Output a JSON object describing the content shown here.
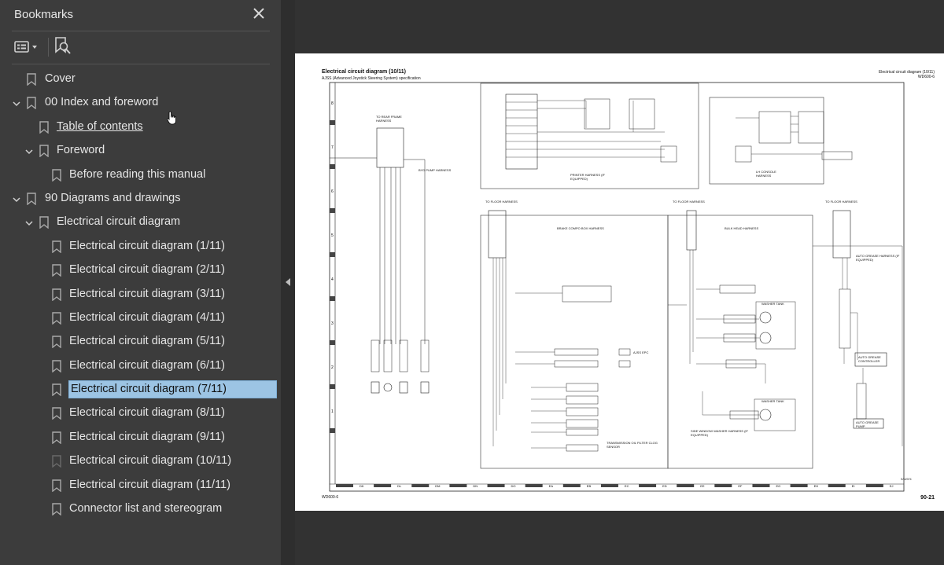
{
  "sidebar": {
    "title": "Bookmarks",
    "close_icon": "close-icon",
    "toolbar": {
      "options_icon": "bookmark-options-icon",
      "find_icon": "find-bookmark-icon"
    },
    "items": [
      {
        "label": "Cover",
        "level": 0,
        "expanded": null,
        "selected": false,
        "underline": false
      },
      {
        "label": "00 Index and foreword",
        "level": 0,
        "expanded": true,
        "selected": false,
        "underline": false
      },
      {
        "label": "Table of contents",
        "level": 1,
        "expanded": null,
        "selected": false,
        "underline": true
      },
      {
        "label": "Foreword",
        "level": 1,
        "expanded": true,
        "selected": false,
        "underline": false
      },
      {
        "label": "Before reading this manual",
        "level": 2,
        "expanded": null,
        "selected": false,
        "underline": false
      },
      {
        "label": "90 Diagrams and drawings",
        "level": 0,
        "expanded": true,
        "selected": false,
        "underline": false
      },
      {
        "label": "Electrical circuit diagram",
        "level": 1,
        "expanded": true,
        "selected": false,
        "underline": false
      },
      {
        "label": "Electrical circuit diagram (1/11)",
        "level": 2,
        "expanded": null,
        "selected": false,
        "underline": false
      },
      {
        "label": "Electrical circuit diagram (2/11)",
        "level": 2,
        "expanded": null,
        "selected": false,
        "underline": false
      },
      {
        "label": "Electrical circuit diagram (3/11)",
        "level": 2,
        "expanded": null,
        "selected": false,
        "underline": false
      },
      {
        "label": "Electrical circuit diagram (4/11)",
        "level": 2,
        "expanded": null,
        "selected": false,
        "underline": false
      },
      {
        "label": "Electrical circuit diagram (5/11)",
        "level": 2,
        "expanded": null,
        "selected": false,
        "underline": false
      },
      {
        "label": "Electrical circuit diagram (6/11)",
        "level": 2,
        "expanded": null,
        "selected": false,
        "underline": false
      },
      {
        "label": "Electrical circuit diagram (7/11)",
        "level": 2,
        "expanded": null,
        "selected": true,
        "underline": false
      },
      {
        "label": "Electrical circuit diagram (8/11)",
        "level": 2,
        "expanded": null,
        "selected": false,
        "underline": false
      },
      {
        "label": "Electrical circuit diagram (9/11)",
        "level": 2,
        "expanded": null,
        "selected": false,
        "underline": false
      },
      {
        "label": "Electrical circuit diagram (10/11)",
        "level": 2,
        "expanded": null,
        "selected": false,
        "underline": false
      },
      {
        "label": "Electrical circuit diagram (11/11)",
        "level": 2,
        "expanded": null,
        "selected": false,
        "underline": false
      },
      {
        "label": "Connector list and stereogram",
        "level": 2,
        "expanded": null,
        "selected": false,
        "underline": false
      }
    ]
  },
  "page": {
    "title": "Electrical circuit diagram (10/11)",
    "subtitle": "AJSS (Advanced Joystick Steering System) specification",
    "header_right_1": "Electrical circuit diagram (10/11)",
    "header_right_2": "WD600-6",
    "footer_left": "WD600-6",
    "footer_right": "90-21",
    "labels": {
      "to_rear_frame": "TO REAR FRAME HARNESS",
      "byd_pump": "BYD PUMP HARNESS",
      "printer_harness": "PRINTER HARNESS (IF EQUIPPED)",
      "to_floor_1": "TO FLOOR HARNESS",
      "to_floor_2": "TO FLOOR HARNESS",
      "to_floor_3": "TO FLOOR HARNESS",
      "brake_box": "BRAKE COMPO BOX HARNESS",
      "bulk_head": "BULK HEAD HARNESS",
      "auto_grease_harness": "AUTO GREASE HARNESS (IF EQUIPPED)",
      "lh_console": "LH CONSOLE HARNESS",
      "washer_tank_1": "WASHER TANK",
      "washer_tank_2": "WASHER TANK",
      "ajss_epc": "AJSS EPC",
      "side_window": "SIDE WINDOW WASHER HARNESS (IF EQUIPPED)",
      "auto_grease_ctrl": "AUTO GREASE CONTROLLER",
      "auto_grease_pump": "AUTO GREASE PUMP",
      "trans_filter": "TRANSMISSION OIL FILTER CLOG SENSOR",
      "drawing_no": "S/N2374"
    },
    "border_cols": [
      "DK",
      "DL",
      "DM",
      "DN",
      "DO",
      "EA",
      "EB",
      "EC",
      "ED",
      "EE",
      "EF",
      "EG",
      "EH",
      "EI",
      "EJ"
    ],
    "border_rows": [
      "8",
      "7",
      "6",
      "5",
      "4",
      "3",
      "2",
      "1"
    ]
  }
}
